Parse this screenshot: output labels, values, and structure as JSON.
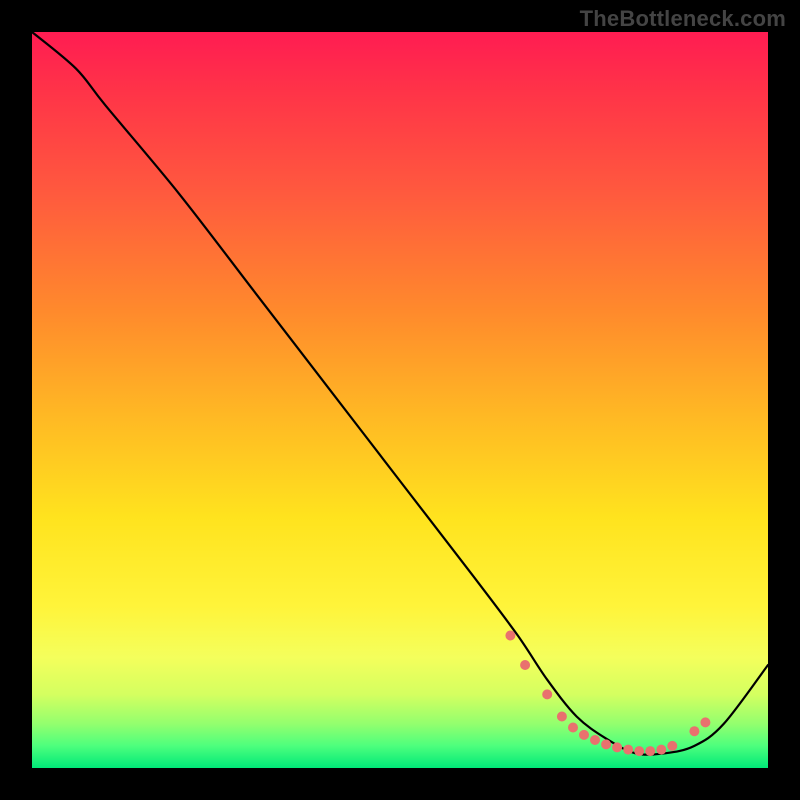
{
  "attribution": "TheBottleneck.com",
  "chart_data": {
    "type": "line",
    "title": "",
    "xlabel": "",
    "ylabel": "",
    "xlim": [
      0,
      100
    ],
    "ylim": [
      0,
      100
    ],
    "series": [
      {
        "name": "curve",
        "x": [
          0,
          6,
          10,
          20,
          30,
          40,
          50,
          60,
          66,
          70,
          74,
          78,
          82,
          86,
          90,
          94,
          100
        ],
        "y": [
          100,
          95,
          90,
          78,
          65,
          52,
          39,
          26,
          18,
          12,
          7,
          4,
          2,
          2,
          3,
          6,
          14
        ]
      }
    ],
    "markers": {
      "name": "sweet-spot-dots",
      "color": "#e9716e",
      "x": [
        65,
        67,
        70,
        72,
        73.5,
        75,
        76.5,
        78,
        79.5,
        81,
        82.5,
        84,
        85.5,
        87,
        90,
        91.5
      ],
      "y": [
        18,
        14,
        10,
        7,
        5.5,
        4.5,
        3.8,
        3.2,
        2.8,
        2.5,
        2.3,
        2.3,
        2.5,
        3.0,
        5.0,
        6.2
      ]
    }
  }
}
